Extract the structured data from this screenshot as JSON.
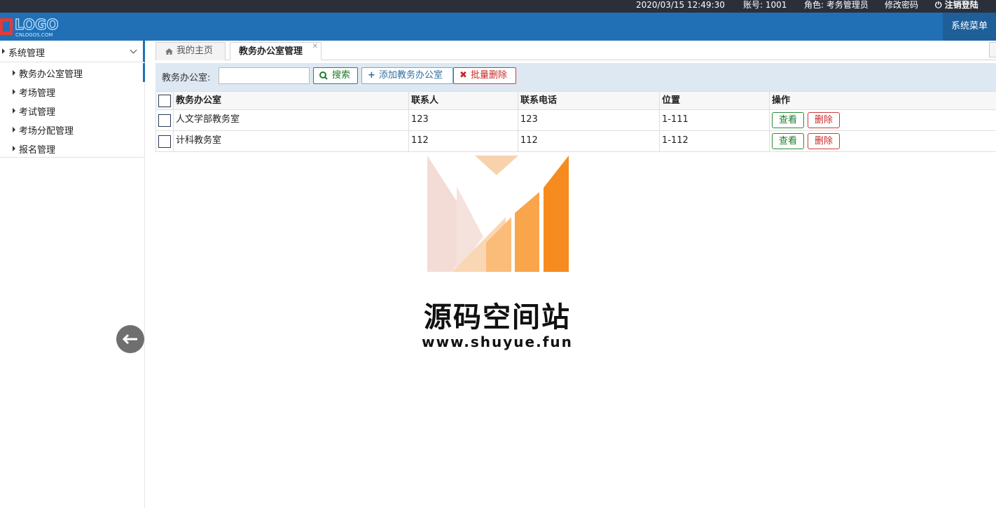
{
  "topbar": {
    "datetime": "2020/03/15 12:49:30",
    "account": "账号: 1001",
    "role": "角色: 考务管理员",
    "change_password": "修改密码",
    "logout": "注销登陆"
  },
  "header": {
    "logo_text": "LOGO",
    "logo_sub": "CNLOGOS.COM",
    "system_menu": "系统菜单"
  },
  "sidebar": {
    "group_label": "系统管理",
    "items": [
      {
        "label": "教务办公室管理",
        "active": true
      },
      {
        "label": "考场管理"
      },
      {
        "label": "考试管理"
      },
      {
        "label": "考场分配管理"
      },
      {
        "label": "报名管理"
      }
    ]
  },
  "tabs": {
    "home": "我的主页",
    "current": "教务办公室管理"
  },
  "toolbar": {
    "field_label": "教务办公室:",
    "search_value": "",
    "search_button": "搜索",
    "add_button": "添加教务办公室",
    "batch_delete_button": "批量删除"
  },
  "table": {
    "columns": [
      "教务办公室",
      "联系人",
      "联系电话",
      "位置",
      "操作"
    ],
    "rows": [
      {
        "office": "人文学部教务室",
        "contact": "123",
        "phone": "123",
        "location": "1-111"
      },
      {
        "office": "计科教务室",
        "contact": "112",
        "phone": "112",
        "location": "1-112"
      }
    ],
    "view_label": "查看",
    "delete_label": "删除"
  },
  "watermark": {
    "title": "源码空间站",
    "url": "www.shuyue.fun"
  },
  "colors": {
    "header_blue": "#2170b6",
    "topbar_dark": "#2b2f3a",
    "success_green": "#2e8b3a",
    "danger_red": "#cf3a3a"
  }
}
